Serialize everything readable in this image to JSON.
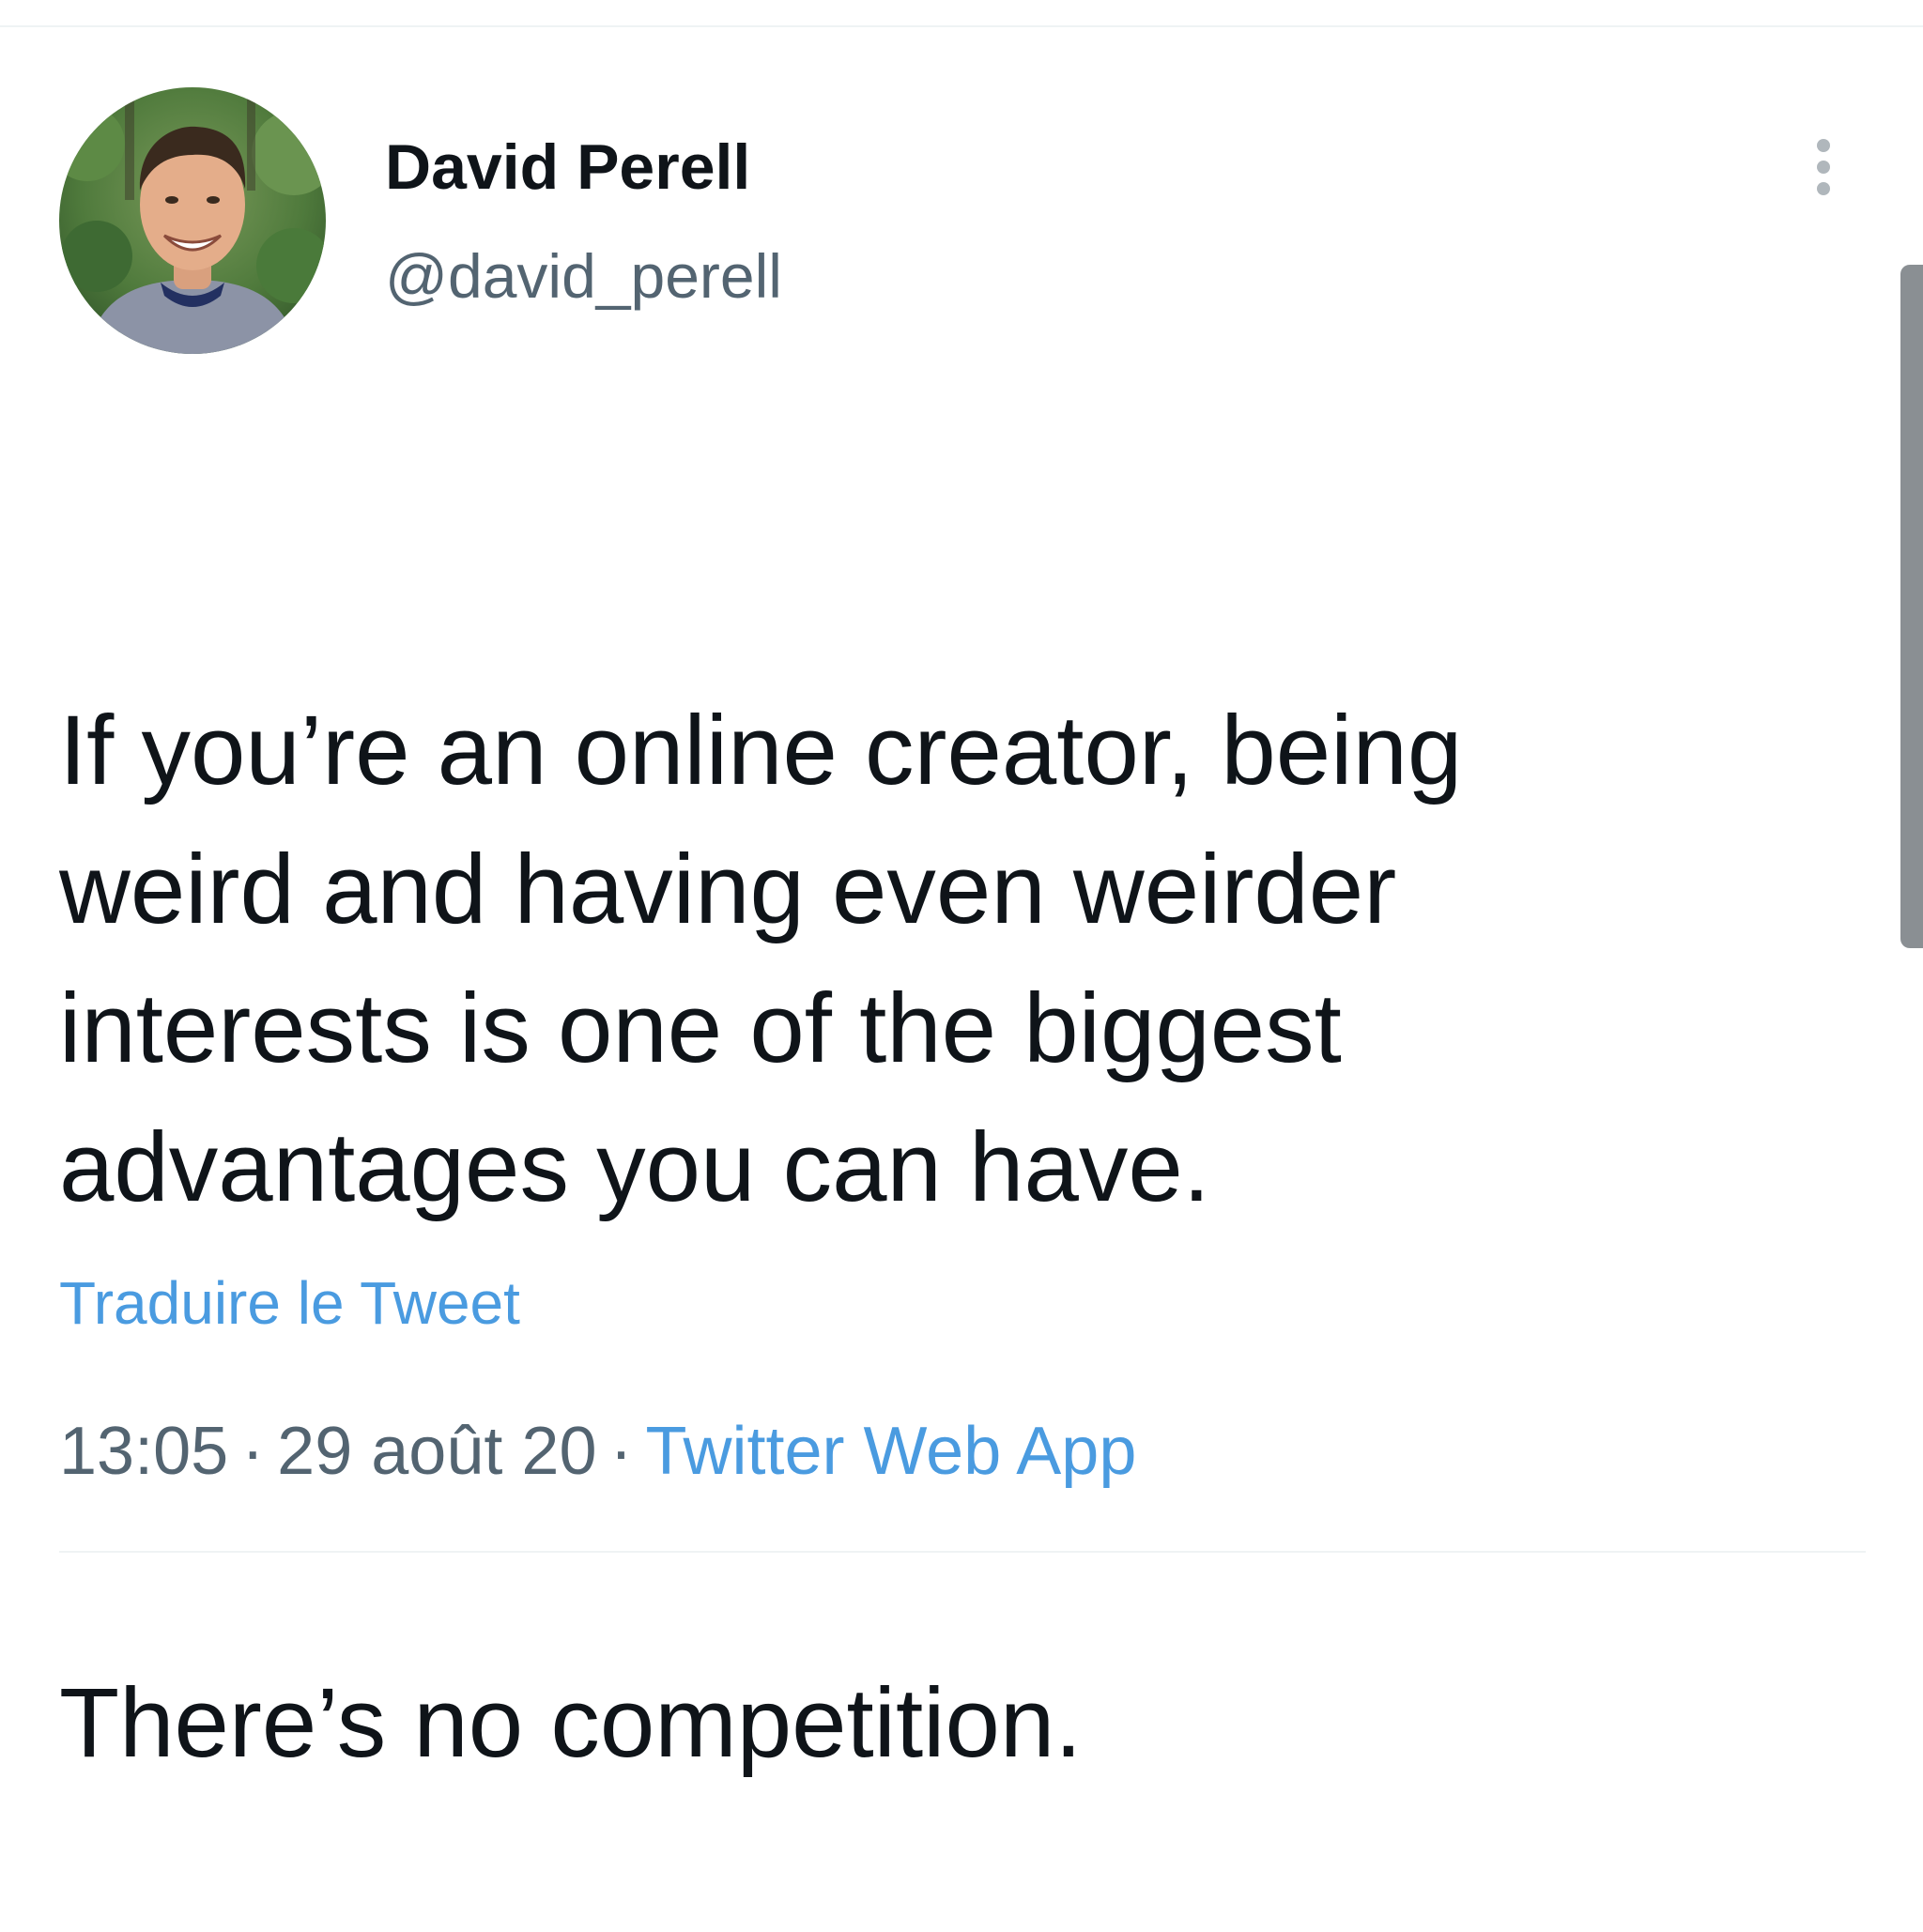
{
  "tweet": {
    "author": {
      "display_name": "David Perell",
      "handle": "@david_perell",
      "avatar_icon": "profile-photo"
    },
    "menu_icon": "vertical-ellipsis-icon",
    "text_paragraphs": [
      "If you’re an online creator, being\nweird and having even weirder\ninterests is one of the biggest\nadvantages you can have.",
      "There’s no competition."
    ],
    "translate_label": "Traduire le Tweet",
    "meta": {
      "time": "13:05",
      "separator": "·",
      "date": "29 août 20",
      "source": "Twitter Web App"
    }
  },
  "colors": {
    "text_primary": "#0f1419",
    "text_secondary": "#536471",
    "link": "#4a9be0",
    "divider": "#eff3f4"
  }
}
